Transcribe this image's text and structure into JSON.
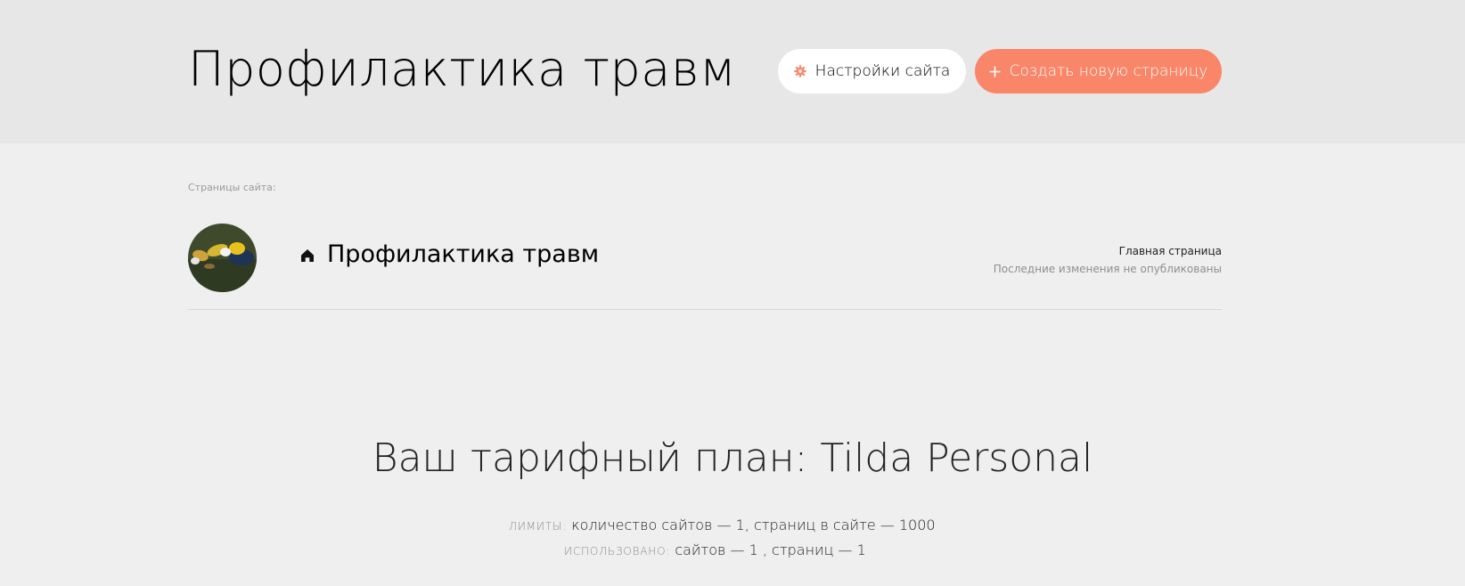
{
  "header": {
    "title": "Профилактика травм",
    "settings_button": "Настройки сайта",
    "create_button": "Создать новую страницу",
    "settings_icon": "gear-icon",
    "create_icon": "plus-icon"
  },
  "pages": {
    "label": "Страницы сайта:",
    "items": [
      {
        "title": "Профилактика травм",
        "icon": "home-icon",
        "kind": "Главная страница",
        "status": "Последние изменения не опубликованы"
      }
    ]
  },
  "plan": {
    "title": "Ваш тарифный план: Tilda Personal",
    "limits_label": "лимиты:",
    "limits_value": "количество сайтов — 1, страниц в сайте — 1000",
    "used_label": "использовано:",
    "used_value": "сайтов — 1 , страниц — 1"
  },
  "colors": {
    "accent": "#fa8669",
    "header_bg": "#e7e7e7",
    "page_bg": "#efefef"
  }
}
